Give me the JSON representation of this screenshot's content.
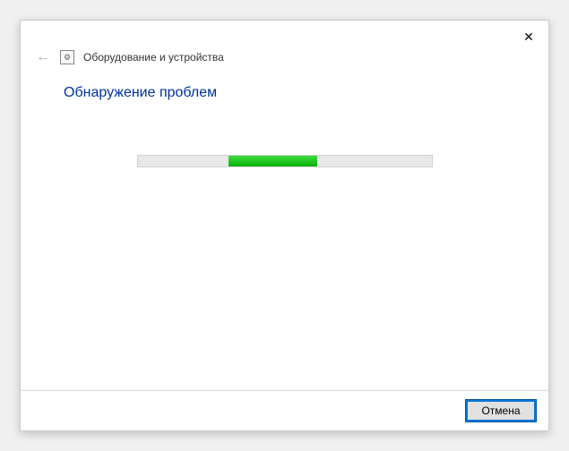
{
  "window": {
    "title": "Оборудование и устройства"
  },
  "content": {
    "status_heading": "Обнаружение проблем"
  },
  "footer": {
    "cancel_label": "Отмена"
  },
  "progress": {
    "mode": "indeterminate"
  }
}
